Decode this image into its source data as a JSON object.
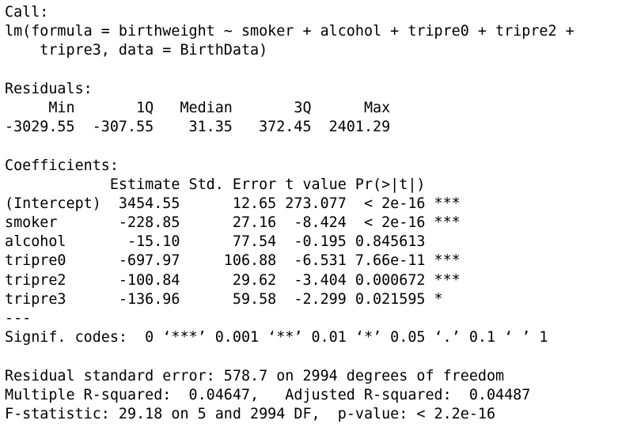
{
  "console": {
    "call_header": "Call:",
    "call_line1": "lm(formula = birthweight ~ smoker + alcohol + tripre0 + tripre2 +",
    "call_line2": "    tripre3, data = BirthData)",
    "residuals_header": "Residuals:",
    "residuals_labels": "     Min       1Q   Median       3Q      Max ",
    "residuals_values": "-3029.55  -307.55    31.35   372.45  2401.29 ",
    "coefficients_header": "Coefficients:",
    "coef_columns": "            Estimate Std. Error t value Pr(>|t|)    ",
    "coef_rows": [
      "(Intercept)  3454.55      12.65 273.077  < 2e-16 ***",
      "smoker       -228.85      27.16  -8.424  < 2e-16 ***",
      "alcohol       -15.10      77.54  -0.195 0.845613    ",
      "tripre0      -697.97     106.88  -6.531 7.66e-11 ***",
      "tripre2      -100.84      29.62  -3.404 0.000672 ***",
      "tripre3      -136.96      59.58  -2.299 0.021595 *  "
    ],
    "separator": "---",
    "signif_codes": "Signif. codes:  0 ‘***’ 0.001 ‘**’ 0.01 ‘*’ 0.05 ‘.’ 0.1 ‘ ’ 1",
    "residual_se": "Residual standard error: 578.7 on 2994 degrees of freedom",
    "r_squared": "Multiple R-squared:  0.04647,\tAdjusted R-squared:  0.04487 ",
    "f_statistic": "F-statistic: 29.18 on 5 and 2994 DF,  p-value: < 2.2e-16"
  }
}
